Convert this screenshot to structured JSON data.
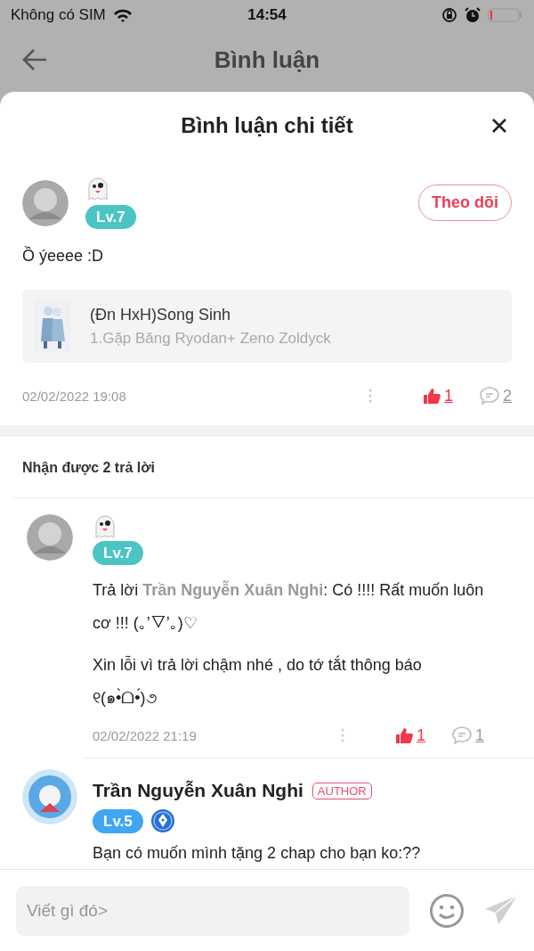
{
  "status_bar": {
    "carrier": "Không có SIM",
    "time": "14:54"
  },
  "header": {
    "title": "Bình luận"
  },
  "sheet": {
    "title": "Bình luận chi tiết"
  },
  "comment": {
    "level": {
      "label": "Lv.7",
      "color": "#4cc4c4"
    },
    "follow_button": "Theo dõi",
    "text": "Ồ ýeeee :D",
    "story": {
      "title": "(Đn HxH)Song Sinh",
      "chapter": "1.Gặp Băng Ryodan+ Zeno Zoldyck"
    },
    "time": "02/02/2022 19:08",
    "likes": "1",
    "liked": true,
    "replies": "2"
  },
  "replies_heading": "Nhận được 2 trả lời",
  "replies": [
    {
      "kind": "reader",
      "level": {
        "label": "Lv.7",
        "color": "#4cc4c4"
      },
      "paragraphs": [
        "Trả lời **Trần Nguyễn Xuân Nghi**: Có !!!! Rất muốn luôn cơ !!! (｡’▽’｡)♡",
        "Xin lỗi vì trả lời chậm nhé , do tớ tắt thông báo ୧(๑•̀ᗝ•́)૭"
      ],
      "time": "02/02/2022 21:19",
      "likes": "1",
      "liked": true,
      "replies": "1"
    },
    {
      "kind": "author",
      "name": "Trần Nguyễn Xuân Nghi",
      "badge": "AUTHOR",
      "level": {
        "label": "Lv.5",
        "color": "#40a6f2"
      },
      "paragraphs": [
        "Bạn có muốn mình tặng 2 chap cho bạn ko:??"
      ]
    }
  ],
  "input": {
    "placeholder": "Viết gì đó>"
  }
}
